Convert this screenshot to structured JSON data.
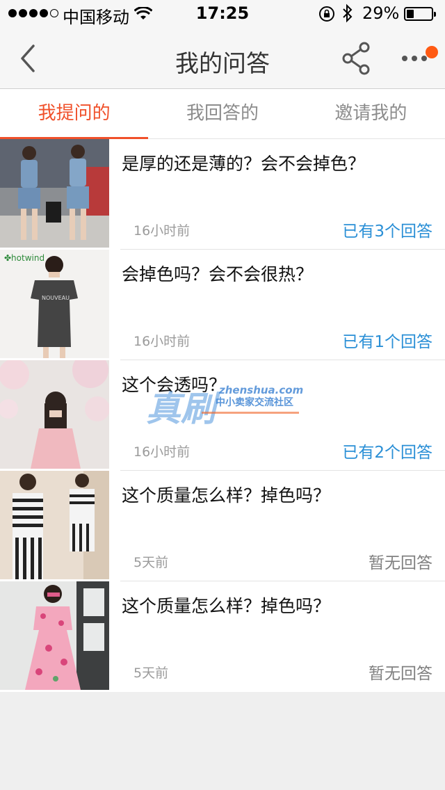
{
  "status_bar": {
    "carrier": "中国移动",
    "time": "17:25",
    "battery": "29%",
    "battery_level": 0.29
  },
  "nav": {
    "title": "我的问答",
    "back_icon": "chevron-left-icon",
    "share_icon": "share-icon",
    "more_icon": "more-icon",
    "notification_color": "#ff5a13"
  },
  "tabs": [
    {
      "label": "我提问的",
      "active": true
    },
    {
      "label": "我回答的",
      "active": false
    },
    {
      "label": "邀请我的",
      "active": false
    }
  ],
  "accent_color": "#f0502a",
  "link_color": "#2a8fd6",
  "questions": [
    {
      "question": "是厚的还是薄的？会不会掉色？",
      "time": "16小时前",
      "answers": "已有3个回答",
      "has_answers": true
    },
    {
      "question": "会掉色吗？会不会很热？",
      "time": "16小时前",
      "answers": "已有1个回答",
      "has_answers": true,
      "thumb_brand": "hotwind"
    },
    {
      "question": "这个会透吗？",
      "time": "16小时前",
      "answers": "已有2个回答",
      "has_answers": true
    },
    {
      "question": "这个质量怎么样？掉色吗？",
      "time": "5天前",
      "answers": "暂无回答",
      "has_answers": false
    },
    {
      "question": "这个质量怎么样？掉色吗？",
      "time": "5天前",
      "answers": "暂无回答",
      "has_answers": false
    }
  ],
  "watermark": {
    "big": "真刷",
    "url": "zhenshua.com",
    "sub": "中小卖家交流社区"
  }
}
